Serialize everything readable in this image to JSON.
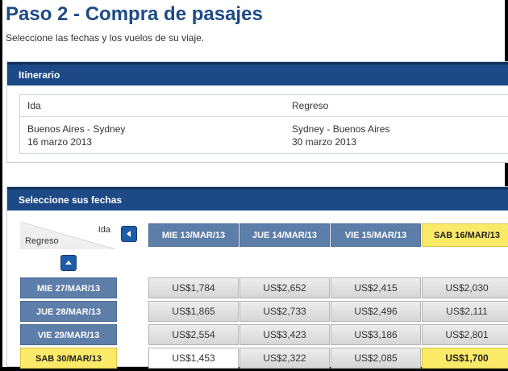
{
  "page": {
    "title": "Paso 2 - Compra de pasajes",
    "subtitle": "Seleccione las fechas y los vuelos de su viaje."
  },
  "itinerary": {
    "header": "Itinerario",
    "ida": {
      "label": "Ida",
      "route": "Buenos Aires - Sydney",
      "date": "16 marzo 2013"
    },
    "regreso": {
      "label": "Regreso",
      "route": "Sydney - Buenos Aires",
      "date": "30 marzo 2013"
    }
  },
  "dates": {
    "header": "Seleccione sus fechas",
    "corner_ida": "Ida",
    "corner_regreso": "Regreso",
    "outbound": [
      "MIE 13/MAR/13",
      "JUE 14/MAR/13",
      "VIE 15/MAR/13",
      "SAB 16/MAR/13"
    ],
    "selected_outbound": "SAB 16/MAR/13",
    "return": [
      "MIE 27/MAR/13",
      "JUE 28/MAR/13",
      "VIE 29/MAR/13",
      "SAB 30/MAR/13"
    ],
    "selected_return": "SAB 30/MAR/13",
    "prices": [
      [
        "US$1,784",
        "US$2,652",
        "US$2,415",
        "US$2,030"
      ],
      [
        "US$1,865",
        "US$2,733",
        "US$2,496",
        "US$2,111"
      ],
      [
        "US$2,554",
        "US$3,423",
        "US$3,186",
        "US$2,801"
      ],
      [
        "US$1,453",
        "US$2,322",
        "US$2,085",
        "US$1,700"
      ]
    ],
    "selected_price": "US$1,700",
    "highlight_color": "#fbe968",
    "header_color": "#5d7ea8"
  }
}
